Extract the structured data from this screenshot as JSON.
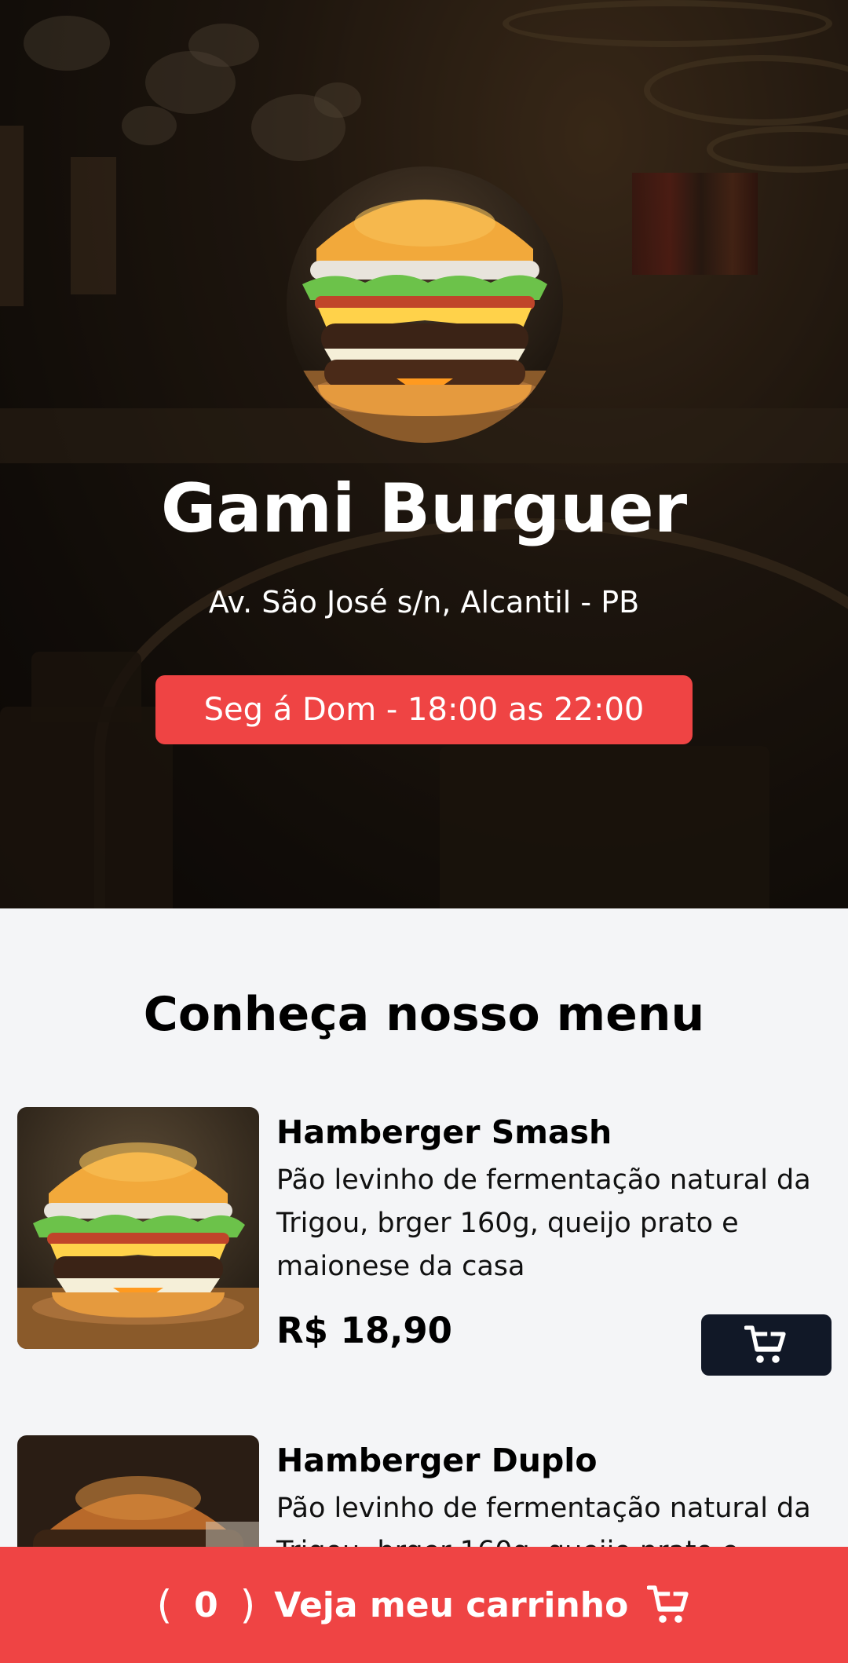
{
  "restaurant": {
    "name": "Gami Burguer",
    "address": "Av. São José s/n, Alcantil - PB",
    "hours": "Seg á Dom - 18:00 as 22:00"
  },
  "menu": {
    "heading": "Conheça nosso menu",
    "items": [
      {
        "name": "Hamberger Smash",
        "description": "Pão levinho de fermentação natural da Trigou, brger 160g, queijo prato e maionese da casa",
        "price": "R$ 18,90",
        "add_icon": "cart-plus-icon"
      },
      {
        "name": "Hamberger Duplo",
        "description": "Pão levinho de fermentação natural da Trigou, brger 160g, queijo prato e",
        "price": "",
        "add_icon": "cart-plus-icon"
      }
    ]
  },
  "cart": {
    "open_paren": "(",
    "count": "0",
    "close_paren": ")",
    "label": "Veja meu carrinho",
    "icon": "cart-plus-icon"
  },
  "colors": {
    "accent": "#ef4444",
    "button_dark": "#111827",
    "background": "#f4f5f7"
  }
}
